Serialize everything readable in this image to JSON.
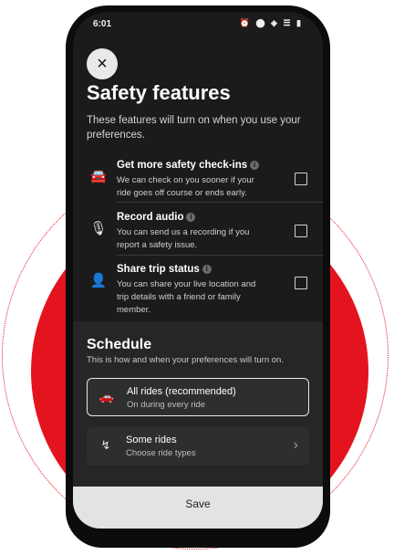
{
  "status_bar": {
    "time": "6:01",
    "icons": "⏰ ⬤ ◈ ☰ ▮"
  },
  "header": {
    "close_icon": "×",
    "title": "Safety features",
    "intro": "These features will turn on when you use your preferences."
  },
  "features": [
    {
      "icon": "car-check-icon",
      "glyph": "🚘",
      "title": "Get more safety check-ins",
      "desc": "We can check on you sooner if your ride goes off course or ends early.",
      "checked": false
    },
    {
      "icon": "microphone-icon",
      "glyph": "🎙",
      "title": "Record audio",
      "desc": "You can send us a recording if you report a safety issue.",
      "checked": false
    },
    {
      "icon": "share-person-icon",
      "glyph": "👤",
      "title": "Share trip status",
      "desc": "You can share your live location and trip details with a friend or family member.",
      "checked": false
    }
  ],
  "schedule": {
    "title": "Schedule",
    "subtitle": "This is how and when your preferences will turn on.",
    "options": [
      {
        "icon": "car-icon",
        "glyph": "🚗",
        "title": "All rides (recommended)",
        "desc": "On during every ride",
        "selected": true
      },
      {
        "icon": "route-icon",
        "glyph": "↯",
        "title": "Some rides",
        "desc": "Choose ride types",
        "selected": false
      }
    ]
  },
  "footer": {
    "save_label": "Save"
  },
  "colors": {
    "accent": "#e3141e",
    "screen_bg": "#1b1b1b",
    "sheet_bg": "#262626"
  }
}
